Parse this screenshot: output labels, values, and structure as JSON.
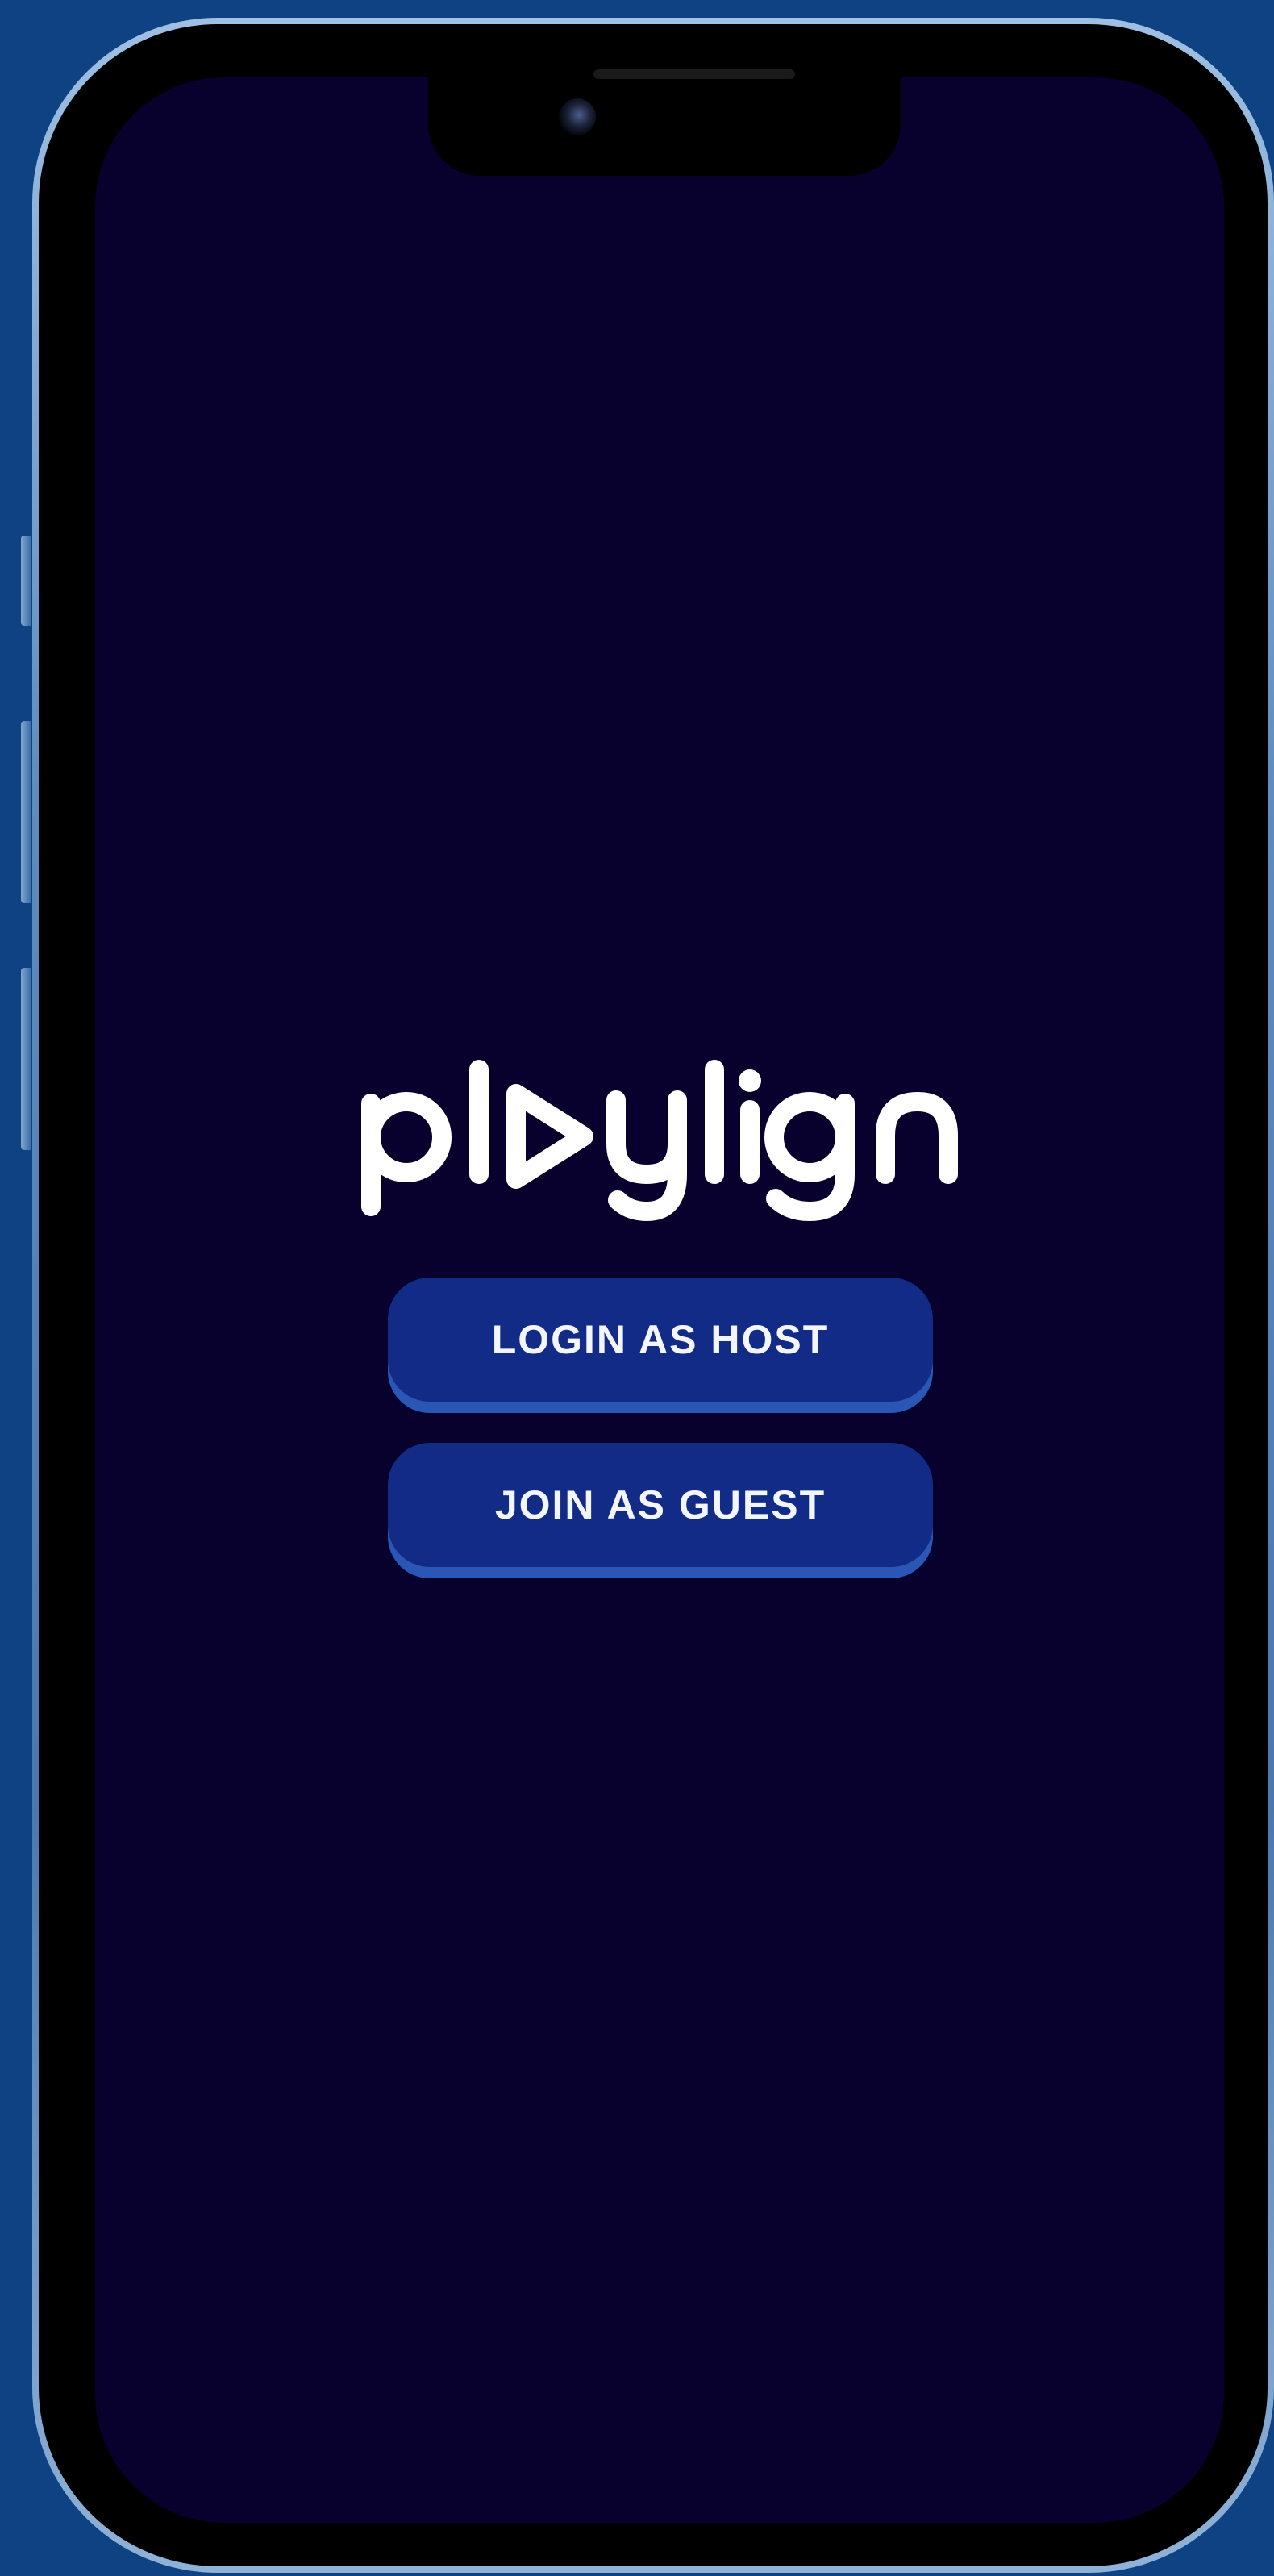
{
  "app": {
    "logo_text": "playlign"
  },
  "buttons": {
    "login_host": "LOGIN AS HOST",
    "join_guest": "JOIN AS GUEST"
  },
  "colors": {
    "page_background": "#0f4283",
    "screen_background": "#08002d",
    "button_fill": "#122b86",
    "button_edge": "#2a56b6",
    "text": "#f4f6ff"
  }
}
